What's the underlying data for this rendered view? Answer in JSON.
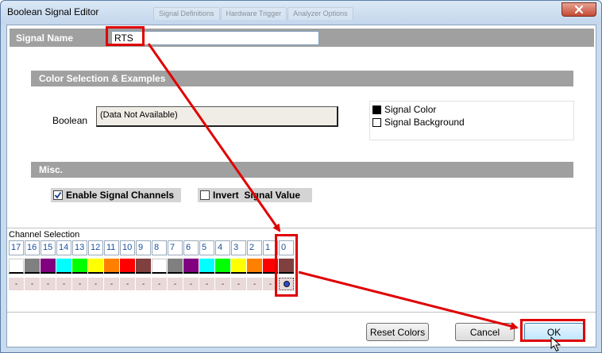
{
  "window": {
    "title": "Boolean Signal Editor",
    "background_tabs": [
      "Signal Definitions",
      "Hardware Trigger",
      "Analyzer Options"
    ]
  },
  "signal": {
    "label": "Signal Name",
    "value": "RTS"
  },
  "color_section": {
    "header": "Color Selection & Examples",
    "boolean_label": "Boolean",
    "boolean_value": "(Data Not Available)",
    "signal_color_label": "Signal Color",
    "signal_background_label": "Signal Background",
    "signal_color": "#000000",
    "signal_background": "#ffffff"
  },
  "misc": {
    "header": "Misc.",
    "enable_channels_label": "Enable Signal Channels",
    "enable_channels_checked": true,
    "invert_label": "Invert  Signal Value",
    "invert_checked": false
  },
  "channels": {
    "label": "Channel Selection",
    "numbers": [
      "17",
      "16",
      "15",
      "14",
      "13",
      "12",
      "11",
      "10",
      "9",
      "8",
      "7",
      "6",
      "5",
      "4",
      "3",
      "2",
      "1",
      "0"
    ],
    "colors": [
      "#ffffff",
      "#808080",
      "#800080",
      "#00ffff",
      "#00ff00",
      "#ffff00",
      "#ff8000",
      "#ff0000",
      "#804040",
      "#ffffff",
      "#808080",
      "#800080",
      "#00ffff",
      "#00ff00",
      "#ffff00",
      "#ff8000",
      "#ff0000",
      "#804040"
    ],
    "radio_marks": [
      "-",
      "-",
      "-",
      "-",
      "-",
      "-",
      "-",
      "-",
      "-",
      "-",
      "-",
      "-",
      "-",
      "-",
      "-",
      "-",
      "-"
    ],
    "selected_channel": "0"
  },
  "buttons": {
    "reset_label": "Reset Colors",
    "cancel_label": "Cancel",
    "ok_label": "OK"
  },
  "annotation_color": "#e00000"
}
